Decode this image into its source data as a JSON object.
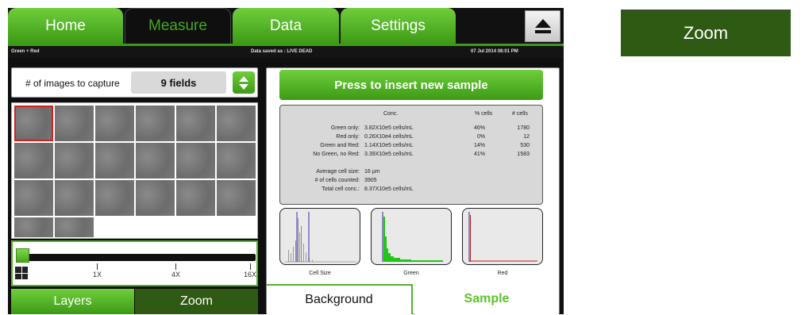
{
  "tabs": {
    "home": "Home",
    "measure": "Measure",
    "data": "Data",
    "settings": "Settings",
    "eject_icon": "eject-icon"
  },
  "status": {
    "left": "Green + Red",
    "center": "Data saved as : LIVE DEAD",
    "right": "07 Jul 2014  08:01 PM"
  },
  "capture": {
    "label": "# of images to capture",
    "value": "9 fields"
  },
  "zoom_slider": {
    "ticks": [
      "1X",
      "4X",
      "16X"
    ],
    "level": "1X"
  },
  "left_buttons": {
    "layers": "Layers",
    "zoom": "Zoom"
  },
  "insert_button": "Press to insert new sample",
  "results": {
    "headers": {
      "conc": "Conc.",
      "pct": "% cells",
      "count": "# cells"
    },
    "rows": [
      {
        "label": "Green only:",
        "conc": "3.82X10e5 cells/mL",
        "pct": "46%",
        "count": "1780"
      },
      {
        "label": "Red only:",
        "conc": "0.26X10e4 cells/mL",
        "pct": "0%",
        "count": "12"
      },
      {
        "label": "Green and Red:",
        "conc": "1.14X10e5 cells/mL",
        "pct": "14%",
        "count": "530"
      },
      {
        "label": "No Green, no Red:",
        "conc": "3.39X10e5 cells/mL",
        "pct": "41%",
        "count": "1583"
      }
    ],
    "summary": [
      {
        "label": "Average cell size:",
        "value": "16 µm"
      },
      {
        "label": "# of cells counted:",
        "value": "3905"
      },
      {
        "label": "Total cell conc.:",
        "value": "8.37X10e5 cells/mL"
      }
    ]
  },
  "histograms": {
    "cell_size": "Cell Size",
    "green": "Green",
    "red": "Red"
  },
  "bottom_buttons": {
    "background": "Background",
    "sample": "Sample"
  },
  "zoom_overlay": "Zoom",
  "colors": {
    "accent_green": "#3d9a16",
    "dark_green": "#2f5a14",
    "selection_red": "#d02020"
  }
}
